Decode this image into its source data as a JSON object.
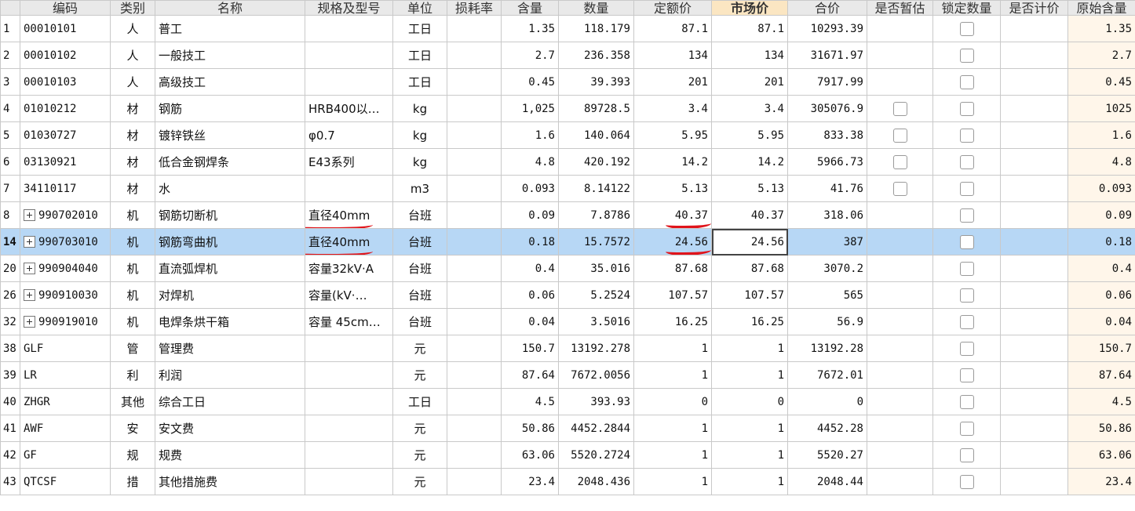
{
  "headers": [
    "编码",
    "类别",
    "名称",
    "规格及型号",
    "单位",
    "损耗率",
    "含量",
    "数量",
    "定额价",
    "市场价",
    "合价",
    "是否暂估",
    "锁定数量",
    "是否计价",
    "原始含量"
  ],
  "rows": [
    {
      "no": "1",
      "code": "00010101",
      "cat": "人",
      "name": "普工",
      "spec": "",
      "unit": "工日",
      "loss": "",
      "qty": "1.35",
      "amount": "118.179",
      "quota": "87.1",
      "market": "87.1",
      "total": "10293.39",
      "est": false,
      "lock": true,
      "priced": "",
      "orig": "1.35"
    },
    {
      "no": "2",
      "code": "00010102",
      "cat": "人",
      "name": "一般技工",
      "spec": "",
      "unit": "工日",
      "loss": "",
      "qty": "2.7",
      "amount": "236.358",
      "quota": "134",
      "market": "134",
      "total": "31671.97",
      "est": false,
      "lock": true,
      "priced": "",
      "orig": "2.7"
    },
    {
      "no": "3",
      "code": "00010103",
      "cat": "人",
      "name": "高级技工",
      "spec": "",
      "unit": "工日",
      "loss": "",
      "qty": "0.45",
      "amount": "39.393",
      "quota": "201",
      "market": "201",
      "total": "7917.99",
      "est": false,
      "lock": true,
      "priced": "",
      "orig": "0.45"
    },
    {
      "no": "4",
      "code": "01010212",
      "cat": "材",
      "name": "钢筋",
      "spec": "HRB400以…",
      "unit": "kg",
      "loss": "",
      "qty": "1,025",
      "amount": "89728.5",
      "quota": "3.4",
      "market": "3.4",
      "total": "305076.9",
      "est": true,
      "lock": true,
      "priced": "",
      "orig": "1025"
    },
    {
      "no": "5",
      "code": "01030727",
      "cat": "材",
      "name": "镀锌铁丝",
      "spec": "φ0.7",
      "unit": "kg",
      "loss": "",
      "qty": "1.6",
      "amount": "140.064",
      "quota": "5.95",
      "market": "5.95",
      "total": "833.38",
      "est": true,
      "lock": true,
      "priced": "",
      "orig": "1.6"
    },
    {
      "no": "6",
      "code": "03130921",
      "cat": "材",
      "name": "低合金钢焊条",
      "spec": "E43系列",
      "unit": "kg",
      "loss": "",
      "qty": "4.8",
      "amount": "420.192",
      "quota": "14.2",
      "market": "14.2",
      "total": "5966.73",
      "est": true,
      "lock": true,
      "priced": "",
      "orig": "4.8"
    },
    {
      "no": "7",
      "code": "34110117",
      "cat": "材",
      "name": "水",
      "spec": "",
      "unit": "m3",
      "loss": "",
      "qty": "0.093",
      "amount": "8.14122",
      "quota": "5.13",
      "market": "5.13",
      "total": "41.76",
      "est": true,
      "lock": true,
      "priced": "",
      "orig": "0.093"
    },
    {
      "no": "8",
      "code": "990702010",
      "cat": "机",
      "name": "钢筋切断机",
      "spec": "直径40mm",
      "unit": "台班",
      "loss": "",
      "qty": "0.09",
      "amount": "7.8786",
      "quota": "40.37",
      "market": "40.37",
      "total": "318.06",
      "est": false,
      "lock": true,
      "priced": "",
      "orig": "0.09",
      "expand": true,
      "mark": true
    },
    {
      "no": "14",
      "code": "990703010",
      "cat": "机",
      "name": "钢筋弯曲机",
      "spec": "直径40mm",
      "unit": "台班",
      "loss": "",
      "qty": "0.18",
      "amount": "15.7572",
      "quota": "24.56",
      "market": "24.56",
      "total": "387",
      "est": false,
      "lock": true,
      "priced": "",
      "orig": "0.18",
      "expand": true,
      "mark": true,
      "selected": true
    },
    {
      "no": "20",
      "code": "990904040",
      "cat": "机",
      "name": "直流弧焊机",
      "spec": "容量32kV·A",
      "unit": "台班",
      "loss": "",
      "qty": "0.4",
      "amount": "35.016",
      "quota": "87.68",
      "market": "87.68",
      "total": "3070.2",
      "est": false,
      "lock": true,
      "priced": "",
      "orig": "0.4",
      "expand": true
    },
    {
      "no": "26",
      "code": "990910030",
      "cat": "机",
      "name": "对焊机",
      "spec": "容量(kV·…",
      "unit": "台班",
      "loss": "",
      "qty": "0.06",
      "amount": "5.2524",
      "quota": "107.57",
      "market": "107.57",
      "total": "565",
      "est": false,
      "lock": true,
      "priced": "",
      "orig": "0.06",
      "expand": true
    },
    {
      "no": "32",
      "code": "990919010",
      "cat": "机",
      "name": "电焊条烘干箱",
      "spec": "容量 45cm…",
      "unit": "台班",
      "loss": "",
      "qty": "0.04",
      "amount": "3.5016",
      "quota": "16.25",
      "market": "16.25",
      "total": "56.9",
      "est": false,
      "lock": true,
      "priced": "",
      "orig": "0.04",
      "expand": true
    },
    {
      "no": "38",
      "code": "GLF",
      "cat": "管",
      "name": "管理费",
      "spec": "",
      "unit": "元",
      "loss": "",
      "qty": "150.7",
      "amount": "13192.278",
      "quota": "1",
      "market": "1",
      "total": "13192.28",
      "est": false,
      "lock": true,
      "priced": "",
      "orig": "150.7"
    },
    {
      "no": "39",
      "code": "LR",
      "cat": "利",
      "name": "利润",
      "spec": "",
      "unit": "元",
      "loss": "",
      "qty": "87.64",
      "amount": "7672.0056",
      "quota": "1",
      "market": "1",
      "total": "7672.01",
      "est": false,
      "lock": true,
      "priced": "",
      "orig": "87.64"
    },
    {
      "no": "40",
      "code": "ZHGR",
      "cat": "其他",
      "name": "综合工日",
      "spec": "",
      "unit": "工日",
      "loss": "",
      "qty": "4.5",
      "amount": "393.93",
      "quota": "0",
      "market": "0",
      "total": "0",
      "est": false,
      "lock": true,
      "priced": "",
      "orig": "4.5"
    },
    {
      "no": "41",
      "code": "AWF",
      "cat": "安",
      "name": "安文费",
      "spec": "",
      "unit": "元",
      "loss": "",
      "qty": "50.86",
      "amount": "4452.2844",
      "quota": "1",
      "market": "1",
      "total": "4452.28",
      "est": false,
      "lock": true,
      "priced": "",
      "orig": "50.86"
    },
    {
      "no": "42",
      "code": "GF",
      "cat": "规",
      "name": "规费",
      "spec": "",
      "unit": "元",
      "loss": "",
      "qty": "63.06",
      "amount": "5520.2724",
      "quota": "1",
      "market": "1",
      "total": "5520.27",
      "est": false,
      "lock": true,
      "priced": "",
      "orig": "63.06"
    },
    {
      "no": "43",
      "code": "QTCSF",
      "cat": "措",
      "name": "其他措施费",
      "spec": "",
      "unit": "元",
      "loss": "",
      "qty": "23.4",
      "amount": "2048.436",
      "quota": "1",
      "market": "1",
      "total": "2048.44",
      "est": false,
      "lock": true,
      "priced": "",
      "orig": "23.4"
    }
  ],
  "colors": {
    "selected_row": "#b7d7f5",
    "header_bg": "#e9e9e9",
    "market_header_bg": "#fbe6c2",
    "annotation_red": "#e0141b",
    "orig_col_bg": "#fff6ea"
  }
}
